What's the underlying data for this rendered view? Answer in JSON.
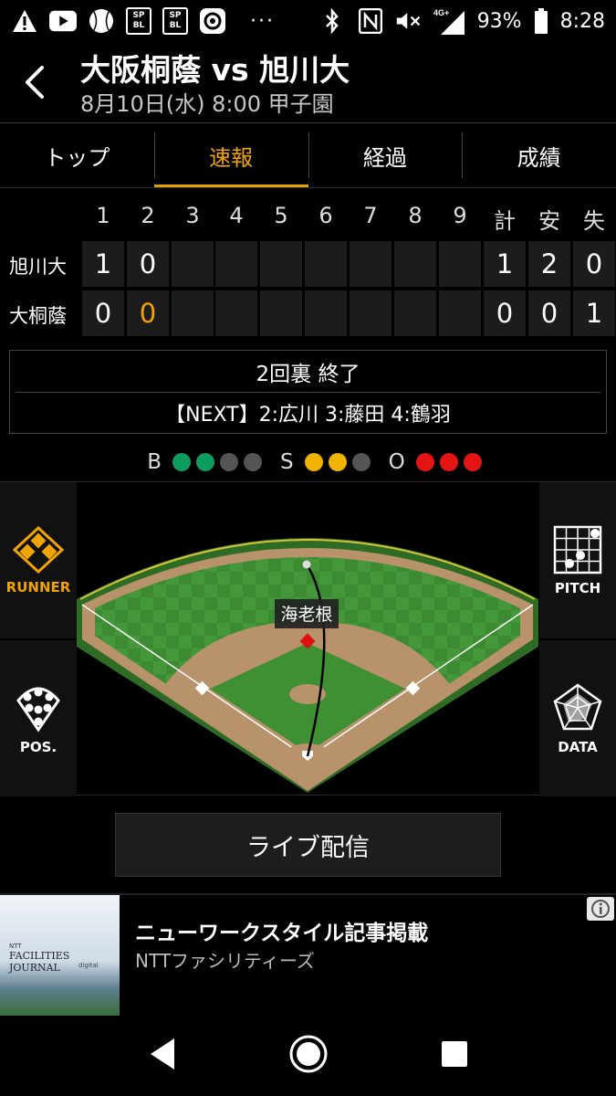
{
  "status_bar": {
    "battery": "93%",
    "time": "8:28",
    "network": "4G+",
    "dots": "···",
    "app_icon_1": "SP\nBL",
    "app_icon_2": "SP\nBL"
  },
  "header": {
    "title": "大阪桐蔭 vs 旭川大",
    "subtitle": "8月10日(水) 8:00 甲子園"
  },
  "tabs": [
    {
      "label": "トップ",
      "active": false
    },
    {
      "label": "速報",
      "active": true
    },
    {
      "label": "経過",
      "active": false
    },
    {
      "label": "成績",
      "active": false
    }
  ],
  "scoreboard": {
    "innings": [
      "1",
      "2",
      "3",
      "4",
      "5",
      "6",
      "7",
      "8",
      "9"
    ],
    "totals_headers": [
      "計",
      "安",
      "失"
    ],
    "teams": [
      {
        "name": "旭川大",
        "innings": [
          "1",
          "0",
          "",
          "",
          "",
          "",
          "",
          "",
          ""
        ],
        "totals": [
          "1",
          "2",
          "0"
        ]
      },
      {
        "name": "大桐蔭",
        "innings": [
          "0",
          "0",
          "",
          "",
          "",
          "",
          "",
          "",
          ""
        ],
        "totals": [
          "0",
          "0",
          "1"
        ]
      }
    ]
  },
  "inning_panel": {
    "status": "2回裏 終了",
    "next": "【NEXT】2:広川 3:藤田 4:鶴羽"
  },
  "count": {
    "ball_label": "B",
    "strike_label": "S",
    "out_label": "O",
    "balls": 2,
    "balls_max": 4,
    "strikes": 2,
    "strikes_max": 3,
    "outs": 3,
    "outs_max": 3,
    "ball_color": "#0e9b5e",
    "strike_color": "#f0b400",
    "out_color": "#e31414",
    "empty_color": "#555555"
  },
  "field": {
    "fielder_label": "海老根"
  },
  "side_buttons": {
    "runner": "RUNNER",
    "pitch": "PITCH",
    "pos": "POS.",
    "data": "DATA"
  },
  "live_button": "ライブ配信",
  "ad": {
    "title": "ニューワークスタイル記事掲載",
    "sponsor": "NTTファシリティーズ",
    "logo_line1": "NTT",
    "logo_line2": "FACILITIES JOURNAL",
    "logo_line3": "digital"
  },
  "colors": {
    "accent": "#f0a400",
    "background": "#000000",
    "grass": "#3d8a32",
    "dirt": "#b8926a"
  }
}
